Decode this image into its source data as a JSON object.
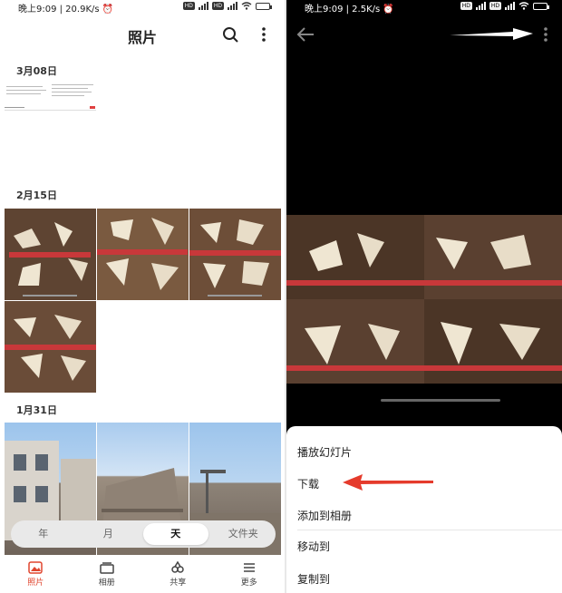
{
  "left": {
    "status": {
      "time_speed": "晚上9:09 | 20.9K/s ⏰",
      "hd": "HD",
      "net4g": "4G",
      "net5g": "5G",
      "battery": "▮"
    },
    "title": "照片",
    "icons": {
      "search": "search-icon",
      "more": "more-vertical-icon"
    },
    "sections": [
      {
        "date": "3月08日"
      },
      {
        "date": "2月15日"
      },
      {
        "date": "1月31日"
      }
    ],
    "view_tabs": [
      {
        "label": "年"
      },
      {
        "label": "月"
      },
      {
        "label": "天",
        "active": true
      },
      {
        "label": "文件夹"
      }
    ],
    "nav": [
      {
        "label": "照片",
        "icon": "photo-icon",
        "active": true
      },
      {
        "label": "相册",
        "icon": "album-icon"
      },
      {
        "label": "共享",
        "icon": "share-icon"
      },
      {
        "label": "更多",
        "icon": "menu-icon"
      }
    ]
  },
  "right": {
    "status": {
      "time_speed": "晚上9:09 | 2.5K/s ⏰",
      "hd": "HD",
      "net4g": "4G",
      "net5g": "5G"
    },
    "icons": {
      "back": "back-arrow-icon",
      "more": "more-vertical-icon"
    },
    "menu": [
      {
        "label": "播放幻灯片"
      },
      {
        "label": "下载"
      },
      {
        "label": "添加到相册"
      },
      {
        "label": "移动到"
      },
      {
        "label": "复制到"
      }
    ]
  },
  "colors": {
    "accent": "#e0452e",
    "arrow_red": "#e53b2c"
  }
}
